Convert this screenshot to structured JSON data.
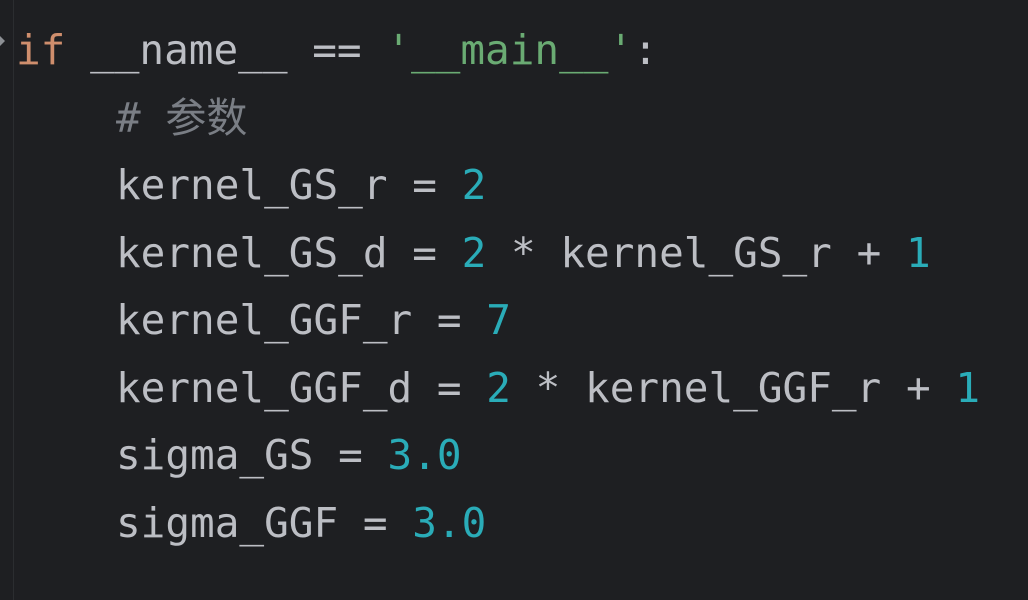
{
  "code": {
    "line1": {
      "keyword": "if",
      "name": "__name__",
      "operator": "==",
      "string": "'__main__'",
      "colon": ":"
    },
    "line2": {
      "hash": "#",
      "comment": "参数"
    },
    "assignments": [
      {
        "lhs": "kernel_GS_r",
        "eq": "=",
        "value": "2"
      },
      {
        "lhs": "kernel_GS_d",
        "eq": "=",
        "coeff": "2",
        "mul": "*",
        "ref": "kernel_GS_r",
        "plus": "+",
        "addend": "1"
      },
      {
        "lhs": "kernel_GGF_r",
        "eq": "=",
        "value": "7"
      },
      {
        "lhs": "kernel_GGF_d",
        "eq": "=",
        "coeff": "2",
        "mul": "*",
        "ref": "kernel_GGF_r",
        "plus": "+",
        "addend": "1"
      },
      {
        "lhs": "sigma_GS",
        "eq": "=",
        "value": "3.0"
      },
      {
        "lhs": "sigma_GGF",
        "eq": "=",
        "value": "3.0"
      }
    ]
  },
  "colors": {
    "background": "#1e1f22",
    "default_text": "#bcbec4",
    "keyword": "#cf8e6d",
    "string": "#6aab73",
    "number": "#2aacb8",
    "comment": "#7a7e85"
  }
}
